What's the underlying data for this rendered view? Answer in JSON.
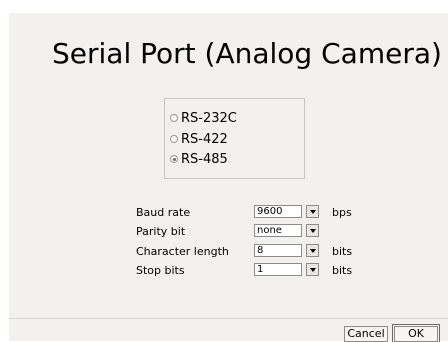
{
  "dialog": {
    "title": "Serial Port (Analog Camera)"
  },
  "interface": {
    "options": [
      {
        "label": "RS-232C",
        "selected": false
      },
      {
        "label": "RS-422",
        "selected": false
      },
      {
        "label": "RS-485",
        "selected": true
      }
    ]
  },
  "settings": {
    "baud_rate": {
      "label": "Baud rate",
      "value": "9600",
      "unit": "bps"
    },
    "parity_bit": {
      "label": "Parity bit",
      "value": "none"
    },
    "character_length": {
      "label": "Character length",
      "value": "8",
      "unit": "bits"
    },
    "stop_bits": {
      "label": "Stop bits",
      "value": "1",
      "unit": "bits"
    }
  },
  "buttons": {
    "cancel": "Cancel",
    "ok": "OK"
  },
  "icons": {
    "dropdown": "chevron-down-icon",
    "radio": "radio-button-icon"
  }
}
